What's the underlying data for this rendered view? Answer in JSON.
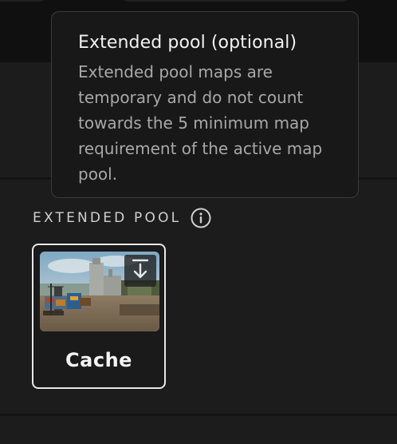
{
  "tooltip": {
    "title": "Extended pool (optional)",
    "body": "Extended pool maps are temporary and do not count towards the 5 minimum map requirement of the active map pool."
  },
  "section": {
    "title": "EXTENDED POOL",
    "info_icon": "info-circle-icon"
  },
  "maps": [
    {
      "name": "Cache",
      "action_icon": "download-icon"
    }
  ],
  "colors": {
    "background": "#1c1c1c",
    "tooltip_bg": "#181818",
    "card_border": "#e8e8e8",
    "muted_text": "#a8a8a8"
  }
}
